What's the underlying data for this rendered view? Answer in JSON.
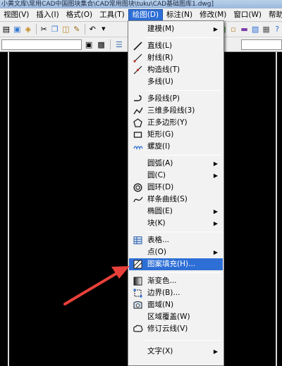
{
  "window": {
    "title": "小黄文库\\常用CAD中国图块集合\\CAD常用图块\\tuku\\CAD基础图库1.dwg]"
  },
  "menubar": [
    {
      "label": "视图(V)",
      "active": false
    },
    {
      "label": "插入(I)",
      "active": false
    },
    {
      "label": "格式(O)",
      "active": false
    },
    {
      "label": "工具(T)",
      "active": false
    },
    {
      "label": "绘图(D)",
      "active": true
    },
    {
      "label": "标注(N)",
      "active": false
    },
    {
      "label": "修改(M)",
      "active": false
    },
    {
      "label": "窗口(W)",
      "active": false
    },
    {
      "label": "帮助",
      "active": false
    }
  ],
  "draw_menu": {
    "items": [
      {
        "label": "建模(M)",
        "icon": "",
        "submenu": true,
        "highlighted": false
      },
      {
        "label": "直线(L)",
        "icon": "line-icon",
        "submenu": false,
        "highlighted": false
      },
      {
        "label": "射线(R)",
        "icon": "ray-icon",
        "submenu": false,
        "highlighted": false
      },
      {
        "label": "构造线(T)",
        "icon": "xline-icon",
        "submenu": false,
        "highlighted": false
      },
      {
        "label": "多线(U)",
        "icon": "",
        "submenu": false,
        "highlighted": false
      },
      {
        "label": "多段线(P)",
        "icon": "polyline-icon",
        "submenu": false,
        "highlighted": false
      },
      {
        "label": "三维多段线(3)",
        "icon": "3d-polyline-icon",
        "submenu": false,
        "highlighted": false
      },
      {
        "label": "正多边形(Y)",
        "icon": "polygon-icon",
        "submenu": false,
        "highlighted": false
      },
      {
        "label": "矩形(G)",
        "icon": "rectangle-icon",
        "submenu": false,
        "highlighted": false
      },
      {
        "label": "螺旋(I)",
        "icon": "helix-icon",
        "submenu": false,
        "highlighted": false
      },
      {
        "label": "圆弧(A)",
        "icon": "",
        "submenu": true,
        "highlighted": false
      },
      {
        "label": "圆(C)",
        "icon": "",
        "submenu": true,
        "highlighted": false
      },
      {
        "label": "圆环(D)",
        "icon": "donut-icon",
        "submenu": false,
        "highlighted": false
      },
      {
        "label": "样条曲线(S)",
        "icon": "spline-icon",
        "submenu": false,
        "highlighted": false
      },
      {
        "label": "椭圆(E)",
        "icon": "",
        "submenu": true,
        "highlighted": false
      },
      {
        "label": "块(K)",
        "icon": "",
        "submenu": true,
        "highlighted": false
      },
      {
        "label": "表格...",
        "icon": "table-icon",
        "submenu": false,
        "highlighted": false
      },
      {
        "label": "点(O)",
        "icon": "",
        "submenu": true,
        "highlighted": false
      },
      {
        "label": "图案填充(H)...",
        "icon": "hatch-icon",
        "submenu": false,
        "highlighted": true
      },
      {
        "label": "渐变色...",
        "icon": "gradient-icon",
        "submenu": false,
        "highlighted": false
      },
      {
        "label": "边界(B)...",
        "icon": "boundary-icon",
        "submenu": false,
        "highlighted": false
      },
      {
        "label": "面域(N)",
        "icon": "region-icon",
        "submenu": false,
        "highlighted": false
      },
      {
        "label": "区域覆盖(W)",
        "icon": "",
        "submenu": false,
        "highlighted": false
      },
      {
        "label": "修订云线(V)",
        "icon": "revcloud-icon",
        "submenu": false,
        "highlighted": false
      },
      {
        "label": "文字(X)",
        "icon": "",
        "submenu": true,
        "highlighted": false
      }
    ]
  },
  "colors": {
    "highlight": "#2e6fd6",
    "annotation_arrow": "#e8403a",
    "canvas": "#000000"
  }
}
